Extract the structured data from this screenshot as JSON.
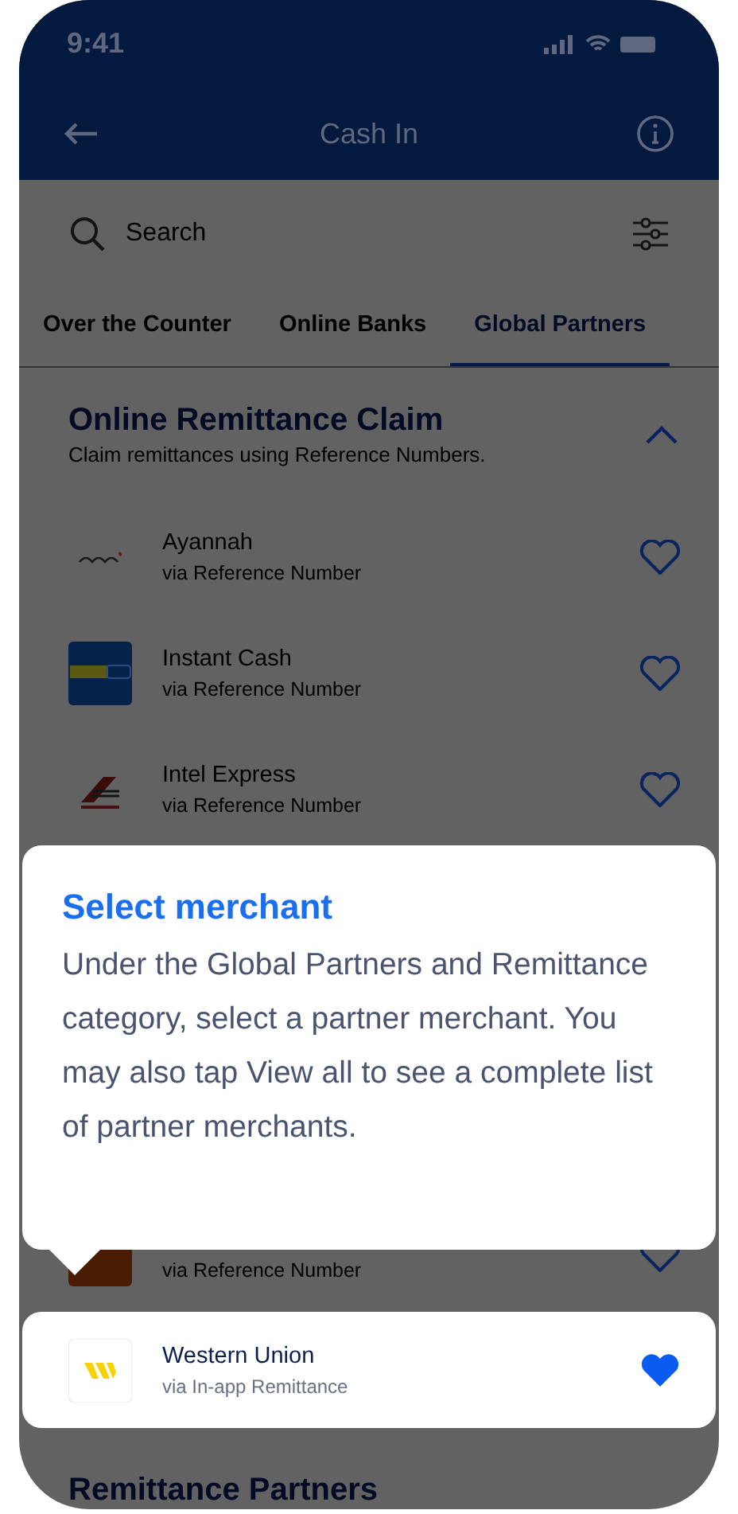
{
  "status_bar": {
    "time": "9:41"
  },
  "header": {
    "title": "Cash In"
  },
  "search": {
    "placeholder": "Search"
  },
  "tabs": [
    {
      "label": "Over the Counter",
      "selected": false
    },
    {
      "label": "Online Banks",
      "selected": false
    },
    {
      "label": "Global Partners",
      "selected": true
    }
  ],
  "section": {
    "title": "Online Remittance Claim",
    "subtitle": "Claim remittances using Reference Numbers.",
    "expanded": true
  },
  "merchants": [
    {
      "kind": "script",
      "name": "Ayannah",
      "method": "via Reference Number",
      "favorite": false,
      "highlighted": false
    },
    {
      "kind": "banner",
      "name": "Instant Cash",
      "method": "via Reference Number",
      "favorite": false,
      "highlighted": false
    },
    {
      "kind": "chevron",
      "name": "Intel Express",
      "method": "via Reference Number",
      "favorite": false,
      "highlighted": false
    },
    {
      "kind": "tile",
      "method": "via Reference Number",
      "favorite": false,
      "highlighted": false
    },
    {
      "kind": "mark",
      "name": "Western Union",
      "method": "via In-app Remittance",
      "favorite": true,
      "highlighted": true
    }
  ],
  "tooltip": {
    "title": "Select merchant",
    "body": "Under the Global Partners and Remittance category, select a partner merchant. You may also tap View all to see a complete list of partner merchants."
  },
  "next_section": {
    "title": "Remittance Partners"
  }
}
